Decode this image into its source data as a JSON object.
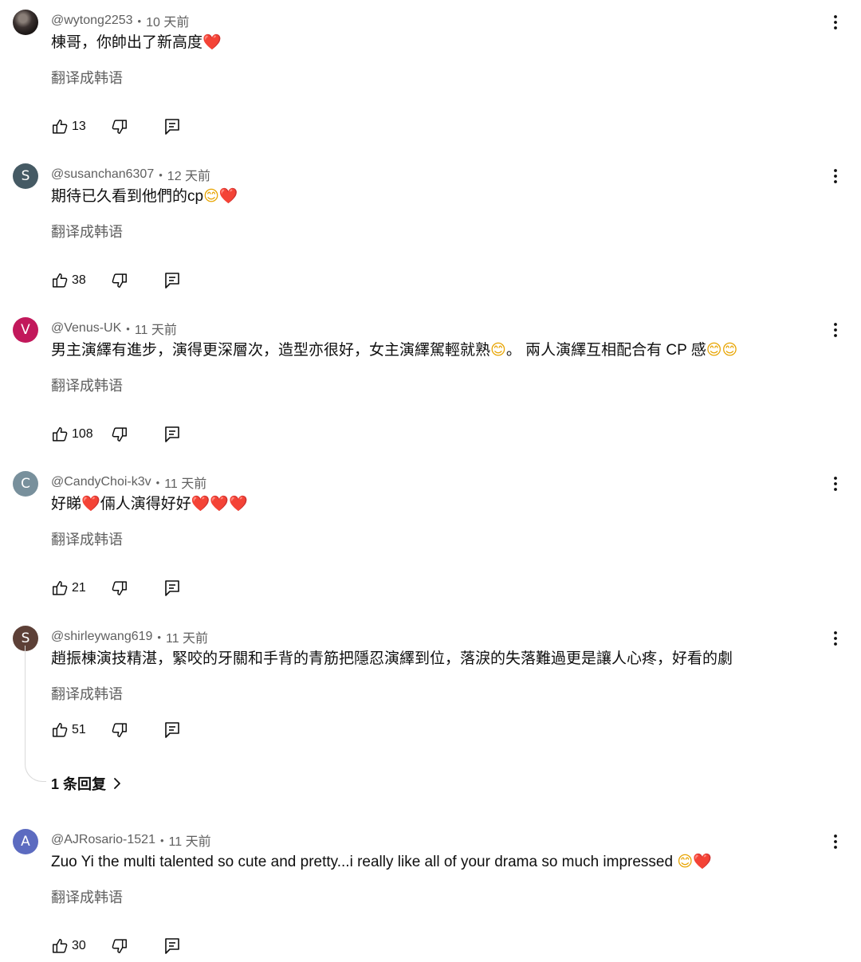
{
  "comments": [
    {
      "avatar": {
        "letter": "",
        "color": "#2b2523",
        "type": "photo"
      },
      "author": "@wytong2253",
      "time": "10 天前",
      "text_parts": [
        {
          "t": "text",
          "v": "棟哥，你帥出了新高度"
        },
        {
          "t": "heart",
          "v": "❤️"
        }
      ],
      "translate": "翻译成韩语",
      "likes": "13"
    },
    {
      "avatar": {
        "letter": "S",
        "color": "#455a64"
      },
      "author": "@susanchan6307",
      "time": "12 天前",
      "text_parts": [
        {
          "t": "text",
          "v": "期待已久看到他們的cp"
        },
        {
          "t": "smiley",
          "v": "😊"
        },
        {
          "t": "heart",
          "v": "❤️"
        }
      ],
      "translate": "翻译成韩语",
      "likes": "38"
    },
    {
      "avatar": {
        "letter": "V",
        "color": "#c2185b"
      },
      "author": "@Venus-UK",
      "time": "11 天前",
      "text_parts": [
        {
          "t": "text",
          "v": "男主演繹有進步，演得更深層次，造型亦很好，女主演繹駕輕就熟"
        },
        {
          "t": "smiley",
          "v": "😊"
        },
        {
          "t": "text",
          "v": "。 兩人演繹互相配合有 CP 感"
        },
        {
          "t": "smiley",
          "v": "😊"
        },
        {
          "t": "smiley",
          "v": "😊"
        }
      ],
      "translate": "翻译成韩语",
      "likes": "108"
    },
    {
      "avatar": {
        "letter": "C",
        "color": "#78909c"
      },
      "author": "@CandyChoi-k3v",
      "time": "11 天前",
      "text_parts": [
        {
          "t": "text",
          "v": "好睇"
        },
        {
          "t": "heart",
          "v": "❤️"
        },
        {
          "t": "text",
          "v": "倆人演得好好"
        },
        {
          "t": "heart",
          "v": "❤️"
        },
        {
          "t": "heart",
          "v": "❤️"
        },
        {
          "t": "heart",
          "v": "❤️"
        }
      ],
      "translate": "翻译成韩语",
      "likes": "21"
    },
    {
      "avatar": {
        "letter": "S",
        "color": "#5d4037"
      },
      "author": "@shirleywang619",
      "time": "11 天前",
      "text_parts": [
        {
          "t": "text",
          "v": "趙振棟演技精湛，緊咬的牙關和手背的青筋把隱忍演繹到位，落淚的失落難過更是讓人心疼，好看的劇"
        }
      ],
      "translate": "翻译成韩语",
      "likes": "51"
    },
    {
      "avatar": {
        "letter": "A",
        "color": "#5c6bc0"
      },
      "author": "@AJRosario-1521",
      "time": "11 天前",
      "text_parts": [
        {
          "t": "text",
          "v": "Zuo Yi the multi talented so cute and pretty...i really like all of your drama so much impressed "
        },
        {
          "t": "smiley",
          "v": "😊"
        },
        {
          "t": "heart",
          "v": "❤️"
        }
      ],
      "translate": "翻译成韩语",
      "likes": "30"
    }
  ],
  "replies_link": {
    "label": "1 条回复"
  },
  "icons": {
    "like": "thumbs-up-icon",
    "dislike": "thumbs-down-icon",
    "reply": "reply-icon",
    "more": "more-vertical-icon",
    "chevron": "chevron-right-icon"
  }
}
